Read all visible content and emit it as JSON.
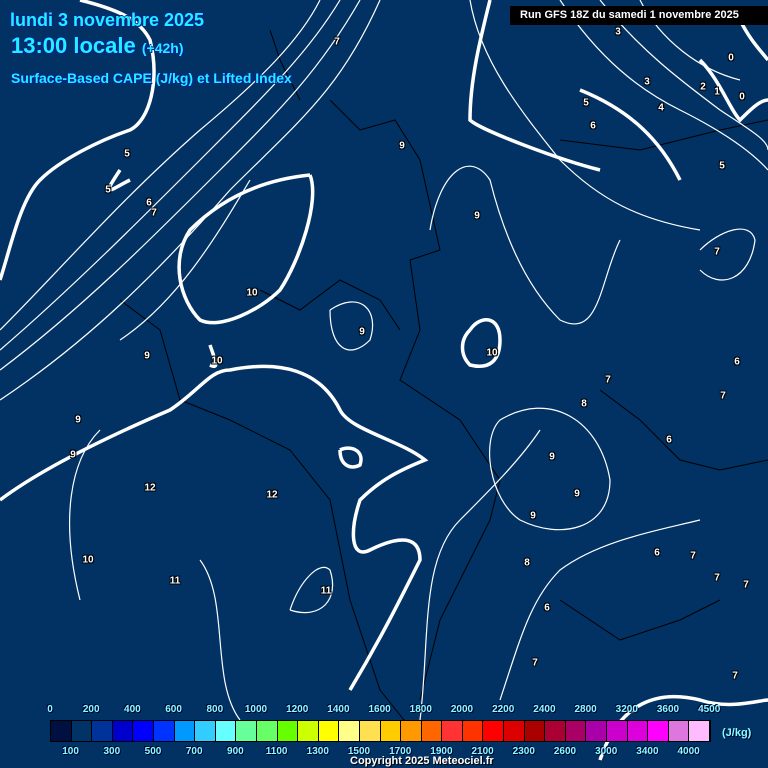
{
  "header": {
    "date": "lundi 3 novembre 2025",
    "time": "13:00 locale",
    "lead": "(+42h)",
    "parameter": "Surface-Based CAPE (J/kg) et Lifted Index"
  },
  "run_label": "Run GFS 18Z du samedi 1 novembre 2025",
  "contour_labels": [
    "7",
    "3",
    "0",
    "3",
    "2",
    "1",
    "0",
    "5",
    "4",
    "6",
    "5",
    "9",
    "5",
    "6",
    "7",
    "5",
    "9",
    "7",
    "10",
    "9",
    "10",
    "9",
    "10",
    "6",
    "7",
    "7",
    "8",
    "9",
    "6",
    "9",
    "9",
    "12",
    "12",
    "9",
    "9",
    "6",
    "7",
    "10",
    "8",
    "7",
    "7",
    "11",
    "11",
    "6",
    "7",
    "7"
  ],
  "legend": {
    "unit": "(J/kg)",
    "colors": [
      "#001040",
      "#003366",
      "#003399",
      "#0000cc",
      "#0000ff",
      "#0033ff",
      "#0099ff",
      "#33ccff",
      "#66ffff",
      "#66ff99",
      "#66ff66",
      "#66ff00",
      "#ccff00",
      "#ffff00",
      "#ffff88",
      "#ffe050",
      "#ffcc00",
      "#ff9900",
      "#ff6600",
      "#ff3333",
      "#ff3300",
      "#ff0000",
      "#dd0000",
      "#aa0000",
      "#aa0033",
      "#aa0066",
      "#aa00aa",
      "#cc00cc",
      "#dd00dd",
      "#ff00ff",
      "#dd77dd",
      "#ffbbff",
      "#ffffff"
    ],
    "thresholds": [
      "0",
      "100",
      "200",
      "300",
      "400",
      "500",
      "600",
      "700",
      "800",
      "900",
      "1000",
      "1100",
      "1200",
      "1300",
      "1400",
      "1500",
      "1600",
      "1700",
      "1800",
      "1900",
      "2000",
      "2100",
      "2200",
      "2300",
      "2400",
      "2600",
      "2800",
      "3000",
      "3200",
      "3400",
      "3600",
      "4000",
      "4500"
    ]
  },
  "copyright": "Copyright 2025 Meteociel.fr"
}
